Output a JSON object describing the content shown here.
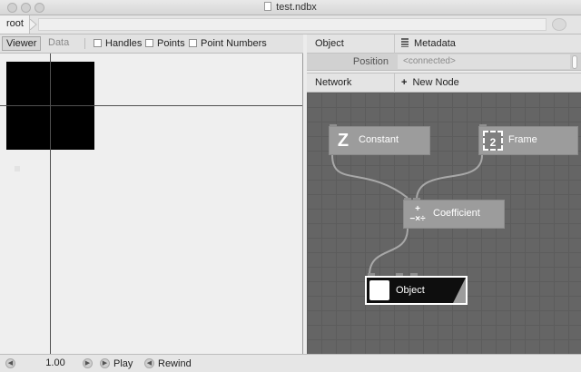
{
  "window": {
    "title": "test.ndbx"
  },
  "address": {
    "root_label": "root"
  },
  "viewer_tabs": {
    "viewer": "Viewer",
    "data": "Data"
  },
  "viewer_toggles": {
    "handles": "Handles",
    "points": "Points",
    "point_numbers": "Point Numbers"
  },
  "port_panel": {
    "header": "Object",
    "metadata": "Metadata",
    "port_name": "Position",
    "port_value": "<connected>"
  },
  "network": {
    "header": "Network",
    "new_node": "New Node"
  },
  "nodes": {
    "constant": {
      "label": "Constant",
      "glyph": "Z"
    },
    "frame": {
      "label": "Frame",
      "glyph": "2"
    },
    "coefficient": {
      "label": "Coefficient",
      "glyph": "+−×÷"
    },
    "object": {
      "label": "Object"
    }
  },
  "playback": {
    "frame_value": "1.00",
    "play": "Play",
    "rewind": "Rewind"
  },
  "colors": {
    "canvas": "#656565",
    "node": "#9c9c9c",
    "rendered_node": "#0e0e0e",
    "wire": "#a8a8a8"
  }
}
